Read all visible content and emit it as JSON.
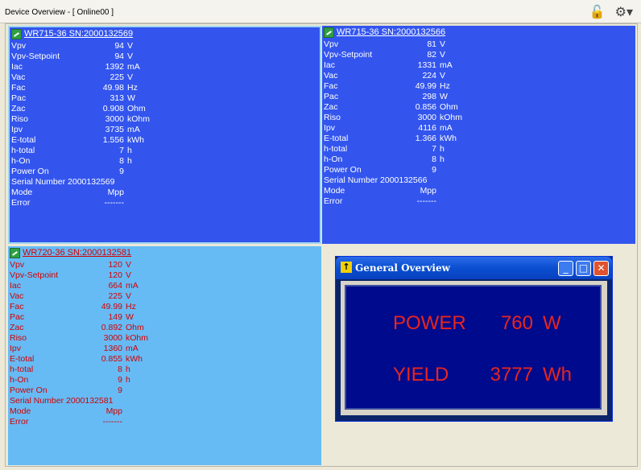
{
  "window": {
    "title": "Device Overview - [ Online00 ]"
  },
  "devices": [
    {
      "name": "WR715-36 SN:2000132569",
      "rows": [
        {
          "label": "Vpv",
          "value": "94",
          "unit": "V"
        },
        {
          "label": "Vpv-Setpoint",
          "value": "94",
          "unit": "V"
        },
        {
          "label": "Iac",
          "value": "1392",
          "unit": "mA"
        },
        {
          "label": "Vac",
          "value": "225",
          "unit": "V"
        },
        {
          "label": "Fac",
          "value": "49.98",
          "unit": "Hz"
        },
        {
          "label": "Pac",
          "value": "313",
          "unit": "W"
        },
        {
          "label": "Zac",
          "value": "0.908",
          "unit": "Ohm"
        },
        {
          "label": "Riso",
          "value": "3000",
          "unit": "kOhm"
        },
        {
          "label": "Ipv",
          "value": "3735",
          "unit": "mA"
        },
        {
          "label": "E-total",
          "value": "1.556",
          "unit": "kWh"
        },
        {
          "label": "h-total",
          "value": "7",
          "unit": "h"
        },
        {
          "label": "h-On",
          "value": "8",
          "unit": "h"
        },
        {
          "label": "Power On",
          "value": "9",
          "unit": ""
        }
      ],
      "serial": "Serial Number 2000132569",
      "mode_label": "Mode",
      "mode_value": "Mpp",
      "error_label": "Error",
      "error_value": "-------"
    },
    {
      "name": "WR715-36 SN:2000132566",
      "rows": [
        {
          "label": "Vpv",
          "value": "81",
          "unit": "V"
        },
        {
          "label": "Vpv-Setpoint",
          "value": "82",
          "unit": "V"
        },
        {
          "label": "Iac",
          "value": "1331",
          "unit": "mA"
        },
        {
          "label": "Vac",
          "value": "224",
          "unit": "V"
        },
        {
          "label": "Fac",
          "value": "49.99",
          "unit": "Hz"
        },
        {
          "label": "Pac",
          "value": "298",
          "unit": "W"
        },
        {
          "label": "Zac",
          "value": "0.856",
          "unit": "Ohm"
        },
        {
          "label": "Riso",
          "value": "3000",
          "unit": "kOhm"
        },
        {
          "label": "Ipv",
          "value": "4116",
          "unit": "mA"
        },
        {
          "label": "E-total",
          "value": "1.366",
          "unit": "kWh"
        },
        {
          "label": "h-total",
          "value": "7",
          "unit": "h"
        },
        {
          "label": "h-On",
          "value": "8",
          "unit": "h"
        },
        {
          "label": "Power On",
          "value": "9",
          "unit": ""
        }
      ],
      "serial": "Serial Number 2000132566",
      "mode_label": "Mode",
      "mode_value": "Mpp",
      "error_label": "Error",
      "error_value": "-------"
    },
    {
      "name": "WR720-36 SN:2000132581",
      "rows": [
        {
          "label": "Vpv",
          "value": "120",
          "unit": "V"
        },
        {
          "label": "Vpv-Setpoint",
          "value": "120",
          "unit": "V"
        },
        {
          "label": "Iac",
          "value": "664",
          "unit": "mA"
        },
        {
          "label": "Vac",
          "value": "225",
          "unit": "V"
        },
        {
          "label": "Fac",
          "value": "49.99",
          "unit": "Hz"
        },
        {
          "label": "Pac",
          "value": "149",
          "unit": "W"
        },
        {
          "label": "Zac",
          "value": "0.892",
          "unit": "Ohm"
        },
        {
          "label": "Riso",
          "value": "3000",
          "unit": "kOhm"
        },
        {
          "label": "Ipv",
          "value": "1360",
          "unit": "mA"
        },
        {
          "label": "E-total",
          "value": "0.855",
          "unit": "kWh"
        },
        {
          "label": "h-total",
          "value": "8",
          "unit": "h"
        },
        {
          "label": "h-On",
          "value": "9",
          "unit": "h"
        },
        {
          "label": "Power On",
          "value": "9",
          "unit": ""
        }
      ],
      "serial": "Serial Number 2000132581",
      "mode_label": "Mode",
      "mode_value": "Mpp",
      "error_label": "Error",
      "error_value": "-------"
    }
  ],
  "general_overview": {
    "title": "General Overview",
    "power_label": "POWER",
    "power_value": "760",
    "power_unit": "W",
    "yield_label": "YIELD",
    "yield_value": "3777",
    "yield_unit": "Wh"
  },
  "icons": {
    "lock": "lock-icon",
    "gear": "gear-icon",
    "device": "inverter-icon"
  }
}
